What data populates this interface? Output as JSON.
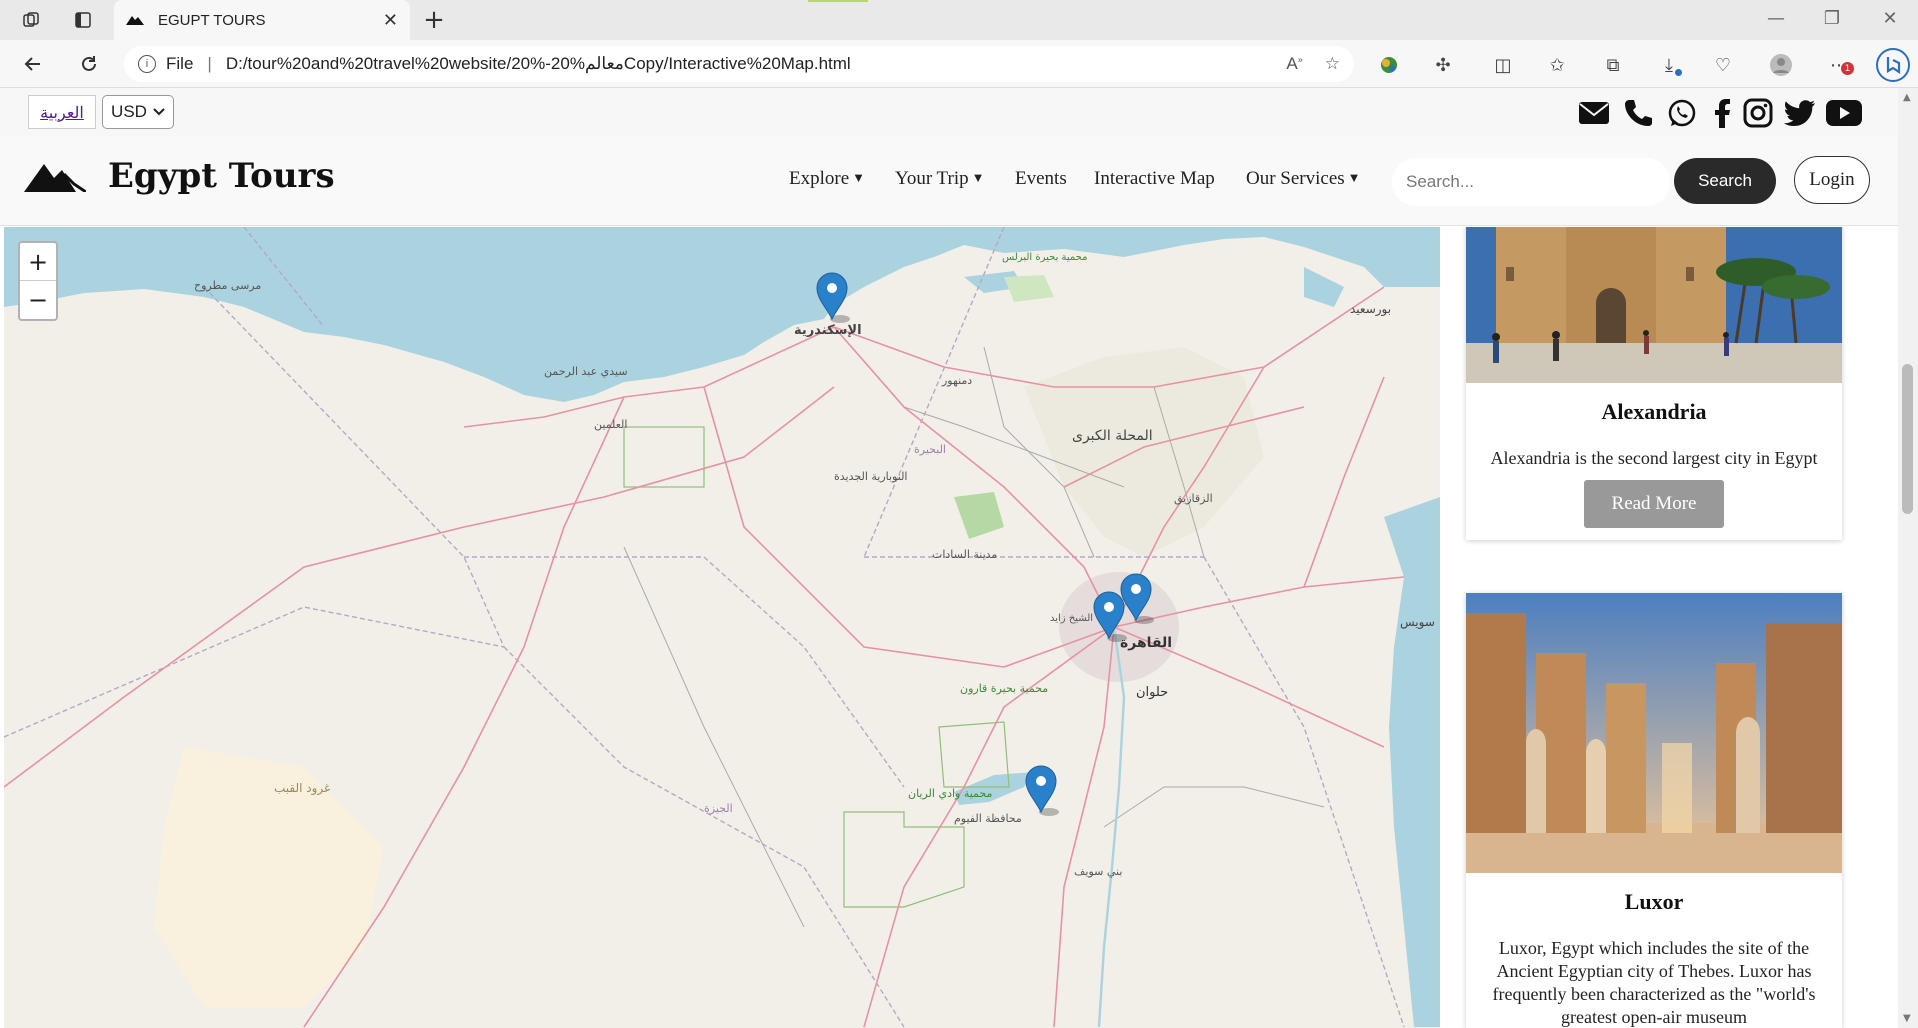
{
  "browser": {
    "tab_title": "EGUPT TOURS",
    "address_prefix": "File",
    "url": "D:/tour%20and%20travel%20website/20%-20%معالمCopy/Interactive%20Map.html",
    "download_badge": "",
    "notif_badge": "1"
  },
  "topbar": {
    "language": "العربية",
    "currency": "USD",
    "currency_options": [
      "USD"
    ]
  },
  "navbar": {
    "brand": "Egypt Tours",
    "menu": [
      {
        "label": "Explore",
        "dropdown": true
      },
      {
        "label": "Your Trip",
        "dropdown": true
      },
      {
        "label": "Events",
        "dropdown": false
      },
      {
        "label": "Interactive Map",
        "dropdown": false
      },
      {
        "label": "Our Services",
        "dropdown": true
      }
    ],
    "search_placeholder": "Search...",
    "search_label": "Search",
    "login_label": "Login"
  },
  "map": {
    "zoom_in": "+",
    "zoom_out": "−",
    "labels": {
      "marsa": "مرسى مطروح",
      "alex": "الإسكندرية",
      "sidi": "سيدي عبد الرحمن",
      "alamein": "العلمين",
      "cairo": "القاهرة",
      "helwan": "حلوان",
      "fayoum": "محافظة الفيوم",
      "beni": "بني سويف",
      "portsaid": "بورسعيد",
      "mahalla": "المحلة الكبرى",
      "damanhur": "دمنهور",
      "sadat": "مدينة السادات",
      "ghorod": "غرود القبب",
      "giza": "الجيزة",
      "suez": "سويس",
      "qarun": "محمية بحيرة قارون",
      "rayan": "محمية وادي الريان",
      "zagazig": "الزقازيق",
      "nubaria": "النوبارية الجديدة",
      "beheira": "البحيرة",
      "sheikh": "الشيخ زايد",
      "burullus": "محمية بحيرة البرلس"
    }
  },
  "cards": [
    {
      "title": "Alexandria",
      "text": "Alexandria is the second largest city in Egypt",
      "button": "Read More"
    },
    {
      "title": "Luxor",
      "text": "Luxor, Egypt which includes the site of the Ancient Egyptian city of Thebes. Luxor has frequently been characterized as the \"world's greatest open-air museum",
      "button": ""
    }
  ],
  "colors": {
    "sea": "#aad3df",
    "land": "#f2efe9",
    "road": "#e892a2",
    "marker": "#2a81cb",
    "nav_dark": "#2a2a2a"
  }
}
